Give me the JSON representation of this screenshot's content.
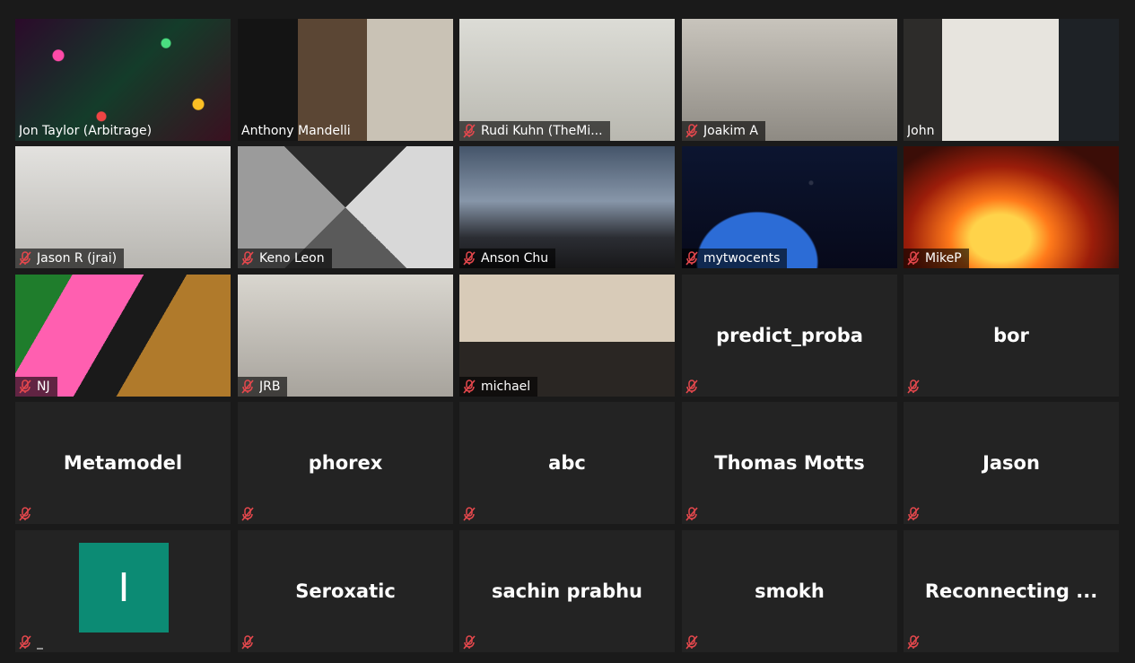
{
  "meeting": {
    "active_speaker_color": "#d8f06a",
    "avatar_color": "#0c8b74",
    "tile_background": "#232323",
    "participants": [
      {
        "name": "Jon Taylor (Arbitrage)",
        "video": true,
        "muted": false,
        "speaking": true
      },
      {
        "name": "Anthony Mandelli",
        "video": true,
        "muted": false
      },
      {
        "name": "Rudi Kuhn (TheMi...",
        "video": true,
        "muted": true
      },
      {
        "name": "Joakim A",
        "video": true,
        "muted": true
      },
      {
        "name": "John",
        "video": true,
        "muted": false
      },
      {
        "name": "Jason R (jrai)",
        "video": true,
        "muted": true
      },
      {
        "name": "Keno Leon",
        "video": true,
        "muted": true
      },
      {
        "name": "Anson Chu",
        "video": true,
        "muted": true
      },
      {
        "name": "mytwocents",
        "video": true,
        "muted": true
      },
      {
        "name": "MikeP",
        "video": true,
        "muted": true
      },
      {
        "name": "NJ",
        "video": true,
        "muted": true
      },
      {
        "name": "JRB",
        "video": true,
        "muted": true
      },
      {
        "name": "michael",
        "video": true,
        "muted": true
      },
      {
        "name": "predict_proba",
        "video": false,
        "muted": true
      },
      {
        "name": "bor",
        "video": false,
        "muted": true
      },
      {
        "name": "Metamodel",
        "video": false,
        "muted": true
      },
      {
        "name": "phorex",
        "video": false,
        "muted": true
      },
      {
        "name": "abc",
        "video": false,
        "muted": true
      },
      {
        "name": "Thomas Motts",
        "video": false,
        "muted": true
      },
      {
        "name": "Jason",
        "video": false,
        "muted": true
      },
      {
        "name": "_",
        "video": false,
        "muted": true,
        "avatar_letter": "I"
      },
      {
        "name": "Seroxatic",
        "video": false,
        "muted": true
      },
      {
        "name": "sachin prabhu",
        "video": false,
        "muted": true
      },
      {
        "name": "smokh",
        "video": false,
        "muted": true
      },
      {
        "name": "Reconnecting ...",
        "video": false,
        "muted": true
      }
    ]
  },
  "icons": {
    "mute": "microphone-muted-icon"
  }
}
